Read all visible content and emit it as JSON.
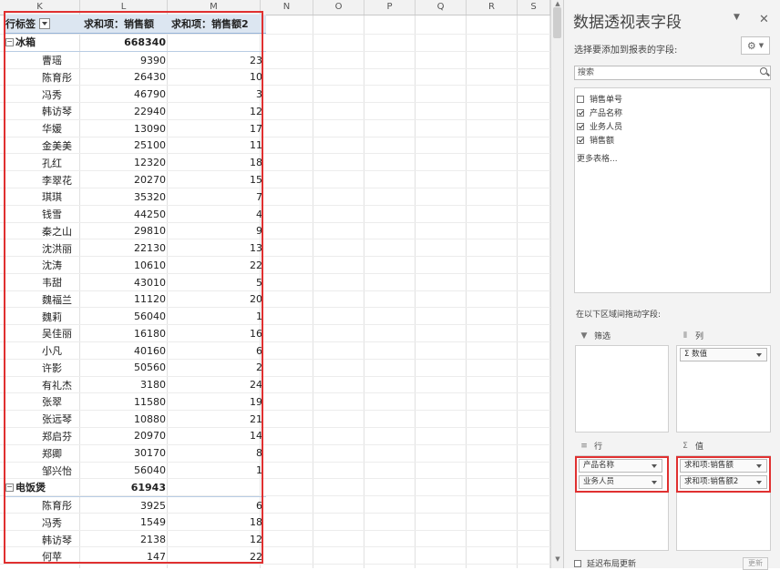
{
  "sheet": {
    "columns": [
      "K",
      "L",
      "M",
      "N",
      "O",
      "P",
      "Q",
      "R",
      "S"
    ]
  },
  "pivot": {
    "header": {
      "label": "行标签",
      "col1": "求和项：销售额",
      "col2": "求和项：销售额2"
    },
    "groups": [
      {
        "name": "冰箱",
        "total": "668340",
        "rows": [
          {
            "name": "曹瑶",
            "v1": "9390",
            "v2": "23"
          },
          {
            "name": "陈育彤",
            "v1": "26430",
            "v2": "10"
          },
          {
            "name": "冯秀",
            "v1": "46790",
            "v2": "3"
          },
          {
            "name": "韩访琴",
            "v1": "22940",
            "v2": "12"
          },
          {
            "name": "华媛",
            "v1": "13090",
            "v2": "17"
          },
          {
            "name": "金美美",
            "v1": "25100",
            "v2": "11"
          },
          {
            "name": "孔红",
            "v1": "12320",
            "v2": "18"
          },
          {
            "name": "李翠花",
            "v1": "20270",
            "v2": "15"
          },
          {
            "name": "琪琪",
            "v1": "35320",
            "v2": "7"
          },
          {
            "name": "钱雪",
            "v1": "44250",
            "v2": "4"
          },
          {
            "name": "秦之山",
            "v1": "29810",
            "v2": "9"
          },
          {
            "name": "沈洪丽",
            "v1": "22130",
            "v2": "13"
          },
          {
            "name": "沈涛",
            "v1": "10610",
            "v2": "22"
          },
          {
            "name": "韦甜",
            "v1": "43010",
            "v2": "5"
          },
          {
            "name": "魏福兰",
            "v1": "11120",
            "v2": "20"
          },
          {
            "name": "魏莉",
            "v1": "56040",
            "v2": "1"
          },
          {
            "name": "吴佳丽",
            "v1": "16180",
            "v2": "16"
          },
          {
            "name": "小凡",
            "v1": "40160",
            "v2": "6"
          },
          {
            "name": "许影",
            "v1": "50560",
            "v2": "2"
          },
          {
            "name": "有礼杰",
            "v1": "3180",
            "v2": "24"
          },
          {
            "name": "张翠",
            "v1": "11580",
            "v2": "19"
          },
          {
            "name": "张远琴",
            "v1": "10880",
            "v2": "21"
          },
          {
            "name": "郑启芬",
            "v1": "20970",
            "v2": "14"
          },
          {
            "name": "郑卿",
            "v1": "30170",
            "v2": "8"
          },
          {
            "name": "邹兴怡",
            "v1": "56040",
            "v2": "1"
          }
        ]
      },
      {
        "name": "电饭煲",
        "total": "61943",
        "rows": [
          {
            "name": "陈育彤",
            "v1": "3925",
            "v2": "6"
          },
          {
            "name": "冯秀",
            "v1": "1549",
            "v2": "18"
          },
          {
            "name": "韩访琴",
            "v1": "2138",
            "v2": "12"
          },
          {
            "name": "何苹",
            "v1": "147",
            "v2": "22"
          }
        ]
      }
    ]
  },
  "panel": {
    "title": "数据透视表字段",
    "choose_label": "选择要添加到报表的字段:",
    "search_placeholder": "搜索",
    "fields": [
      {
        "label": "销售单号",
        "checked": false
      },
      {
        "label": "产品名称",
        "checked": true
      },
      {
        "label": "业务人员",
        "checked": true
      },
      {
        "label": "销售额",
        "checked": true
      }
    ],
    "more_tables": "更多表格...",
    "drag_label": "在以下区域间拖动字段:",
    "areas": {
      "filter": {
        "title": "筛选",
        "items": []
      },
      "columns": {
        "title": "列",
        "items": [
          "Σ 数值"
        ]
      },
      "rows": {
        "title": "行",
        "items": [
          "产品名称",
          "业务人员"
        ]
      },
      "values": {
        "title": "值",
        "items": [
          "求和项:销售额",
          "求和项:销售额2"
        ]
      }
    },
    "defer_label": "延迟布局更新",
    "update_label": "更新"
  }
}
